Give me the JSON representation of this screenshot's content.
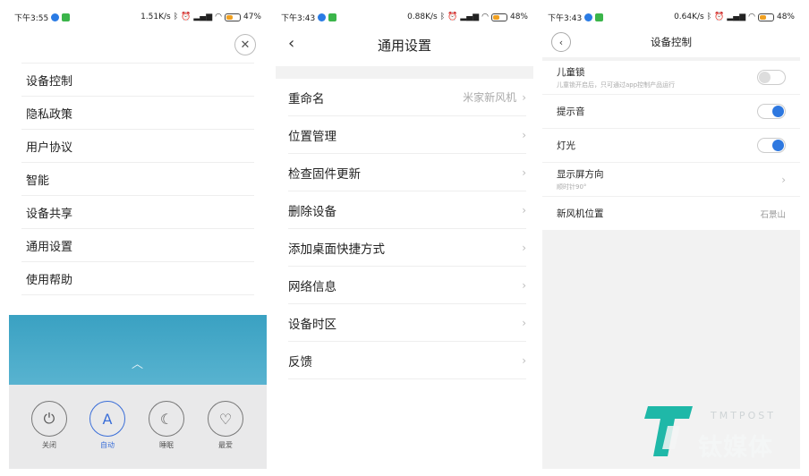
{
  "panel1": {
    "status": {
      "time": "下午3:55",
      "speed": "1.51K/s",
      "battery": "47%"
    },
    "close_icon": "close-icon",
    "menu": [
      "设备控制",
      "隐私政策",
      "用户协议",
      "智能",
      "设备共享",
      "通用设置",
      "使用帮助"
    ],
    "modes": [
      {
        "label": "关闭",
        "icon": "power-icon",
        "active": false
      },
      {
        "label": "自动",
        "icon": "A",
        "active": true
      },
      {
        "label": "睡眠",
        "icon": "moon-icon",
        "active": false
      },
      {
        "label": "最爱",
        "icon": "heart-icon",
        "active": false
      }
    ]
  },
  "panel2": {
    "status": {
      "time": "下午3:43",
      "speed": "0.88K/s",
      "battery": "48%"
    },
    "title": "通用设置",
    "items": [
      {
        "label": "重命名",
        "value": "米家新风机"
      },
      {
        "label": "位置管理",
        "value": ""
      },
      {
        "label": "检查固件更新",
        "value": ""
      },
      {
        "label": "删除设备",
        "value": ""
      },
      {
        "label": "添加桌面快捷方式",
        "value": ""
      },
      {
        "label": "网络信息",
        "value": ""
      },
      {
        "label": "设备时区",
        "value": ""
      },
      {
        "label": "反馈",
        "value": ""
      }
    ]
  },
  "panel3": {
    "status": {
      "time": "下午3:43",
      "speed": "0.64K/s",
      "battery": "48%"
    },
    "title": "设备控制",
    "items": [
      {
        "label": "儿童锁",
        "sub": "儿童锁开启后，只可通过app控制产品运行",
        "toggle": "off"
      },
      {
        "label": "提示音",
        "sub": "",
        "toggle": "on"
      },
      {
        "label": "灯光",
        "sub": "",
        "toggle": "on"
      },
      {
        "label": "显示屏方向",
        "sub": "顺时针90°",
        "arrow": true
      },
      {
        "label": "新风机位置",
        "value": "石景山"
      }
    ]
  },
  "logo": {
    "en": "TMTPOST",
    "cn": "钛媒体",
    "color": "#1fb8a8"
  }
}
